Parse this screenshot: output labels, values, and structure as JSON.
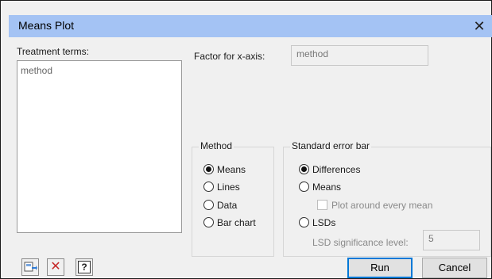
{
  "window": {
    "title": "Means Plot",
    "close_icon": "close-icon"
  },
  "treatment": {
    "label": "Treatment terms:",
    "items": [
      "method"
    ]
  },
  "factor": {
    "label": "Factor for x-axis:",
    "value": "method"
  },
  "method_group": {
    "title": "Method",
    "options": [
      "Means",
      "Lines",
      "Data",
      "Bar chart"
    ],
    "selected": "Means"
  },
  "se_group": {
    "title": "Standard error bar",
    "options": [
      "Differences",
      "Means",
      "LSDs"
    ],
    "selected": "Differences",
    "plot_around_label": "Plot around every mean",
    "lsd_label": "LSD significance level:",
    "lsd_value": "5"
  },
  "toolbar_icons": [
    "save-defaults-icon",
    "clear-icon",
    "help-icon"
  ],
  "toolbar_glyphs": {
    "clear": "✕",
    "help": "?"
  },
  "buttons": {
    "run": "Run",
    "cancel": "Cancel"
  },
  "colors": {
    "titlebar": "#a4c3f4",
    "default_button_border": "#0078d7",
    "clear_icon": "#c62828"
  }
}
